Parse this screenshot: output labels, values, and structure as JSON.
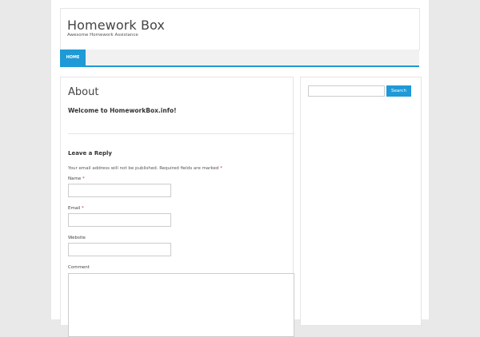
{
  "site": {
    "title": "Homework Box",
    "description": "Awesome Homework Assistance"
  },
  "nav": {
    "items": [
      {
        "label": "HOME",
        "active": true
      }
    ],
    "accent_color": "#1e9ad6"
  },
  "post": {
    "title": "About",
    "text": "Welcome to HomeworkBox.info!"
  },
  "comment_form": {
    "title": "Leave a Reply",
    "notes": "Your email address will not be published. Required fields are marked",
    "required_mark": "*",
    "name_label": "Name",
    "email_label": "Email",
    "website_label": "Website",
    "comment_label": "Comment"
  },
  "search": {
    "button_label": "Search",
    "placeholder": ""
  }
}
